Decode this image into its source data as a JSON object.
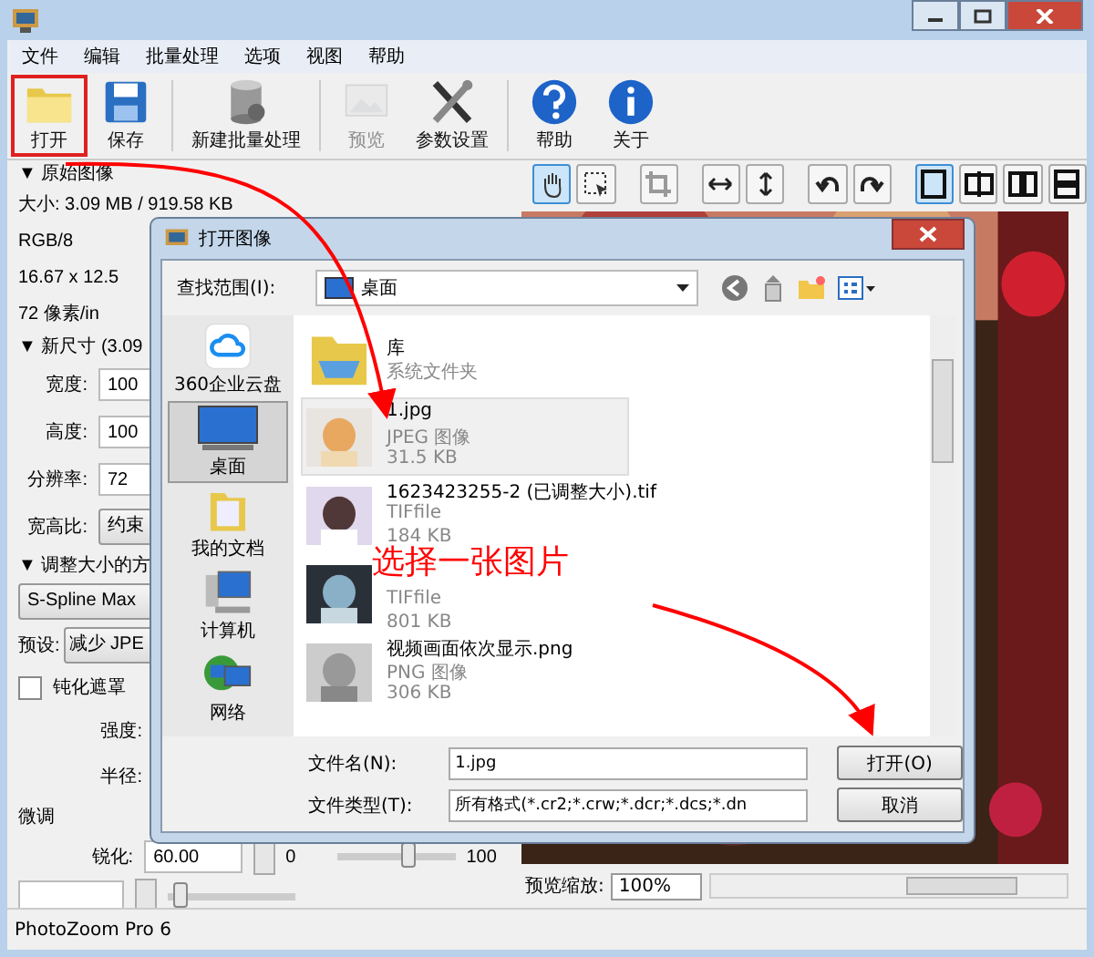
{
  "menu": [
    "文件",
    "编辑",
    "批量处理",
    "选项",
    "视图",
    "帮助"
  ],
  "toolbar": [
    {
      "kind": "folder",
      "label": "打开",
      "disabled": false,
      "highlighted": true
    },
    {
      "kind": "save",
      "label": "保存",
      "disabled": false,
      "highlighted": false
    },
    {
      "kind": "batch",
      "label": "新建批量处理",
      "disabled": false,
      "highlighted": false
    },
    {
      "kind": "preview",
      "label": "预览",
      "disabled": true,
      "highlighted": false
    },
    {
      "kind": "tools",
      "label": "参数设置",
      "disabled": false,
      "highlighted": false
    },
    {
      "kind": "help",
      "label": "帮助",
      "disabled": false,
      "highlighted": false
    },
    {
      "kind": "info",
      "label": "关于",
      "disabled": false,
      "highlighted": false
    }
  ],
  "view_tools": [
    {
      "kind": "hand",
      "selected": true
    },
    {
      "kind": "select",
      "selected": false
    },
    {
      "kind": "crop",
      "selected": false
    },
    {
      "kind": "hflip",
      "selected": false
    },
    {
      "kind": "vflip",
      "selected": false
    },
    {
      "kind": "rotl",
      "selected": false
    },
    {
      "kind": "rotr",
      "selected": false
    },
    {
      "kind": "single",
      "selected": true
    },
    {
      "kind": "split",
      "selected": false
    },
    {
      "kind": "side",
      "selected": false
    },
    {
      "kind": "stack",
      "selected": false
    }
  ],
  "panel": {
    "original_header": "▼ 原始图像",
    "size": "大小: 3.09 MB / 919.58 KB",
    "mode": "RGB/8",
    "dimensions": "16.67 x 12.5",
    "resolution": "72 像素/in",
    "new_size_header": "▼ 新尺寸 (3.09",
    "fields": [
      {
        "label": "宽度:",
        "value": "100"
      },
      {
        "label": "高度:",
        "value": "100"
      },
      {
        "label": "分辨率:",
        "value": "72"
      }
    ],
    "aspect_label": "宽高比:",
    "aspect_value": "约束",
    "method_header": "▼ 调整大小的方",
    "method": "S-Spline Max",
    "preset_label": "预设:",
    "preset": "减少 JPE",
    "unsharp": {
      "label": "钝化遮罩",
      "checked": false
    },
    "strength_label": "强度:",
    "radius_label": "半径:",
    "fine_header": "微调",
    "sharpen_label": "锐化:",
    "sharpen_value": "60.00",
    "sharpen_min": "0",
    "sharpen_max": "100",
    "sharpen_slider": {
      "level": 0.6
    },
    "next_slider": {
      "level": 0.1
    }
  },
  "preview_zoom": {
    "label": "预览缩放:",
    "value": "100%"
  },
  "status": "PhotoZoom Pro 6",
  "dialog": {
    "title": "打开图像",
    "lookin_label": "查找范围(I):",
    "lookin": "桌面",
    "places": [
      {
        "kind": "cloud",
        "label": "360企业云盘",
        "selected": false
      },
      {
        "kind": "desktop",
        "label": "桌面",
        "selected": true
      },
      {
        "kind": "docs",
        "label": "我的文档",
        "selected": false
      },
      {
        "kind": "computer",
        "label": "计算机",
        "selected": false
      },
      {
        "kind": "network",
        "label": "网络",
        "selected": false
      }
    ],
    "files": [
      {
        "kind": "folder",
        "name": "库",
        "type": "系统文件夹",
        "selected": false
      },
      {
        "kind": "picture",
        "name": "1.jpg",
        "type": "JPEG 图像",
        "size": "31.5 KB",
        "selected": true
      },
      {
        "kind": "picture",
        "name": "1623423255-2 (已调整大小).tif",
        "type": "TIFfile",
        "size": "184 KB",
        "selected": false
      },
      {
        "kind": "picture",
        "type": "TIFfile",
        "size": "801 KB",
        "selected": false
      },
      {
        "kind": "picture",
        "name": "视频画面依次显示.png",
        "type": "PNG 图像",
        "size": "306 KB",
        "selected": false
      }
    ],
    "filename_label": "文件名(N):",
    "filename": "1.jpg",
    "filetype_label": "文件类型(T):",
    "filetype": "所有格式(*.cr2;*.crw;*.dcr;*.dcs;*.dn",
    "open_button": "打开(O)",
    "cancel_button": "取消"
  },
  "annotation": {
    "text": "选择一张图片"
  }
}
